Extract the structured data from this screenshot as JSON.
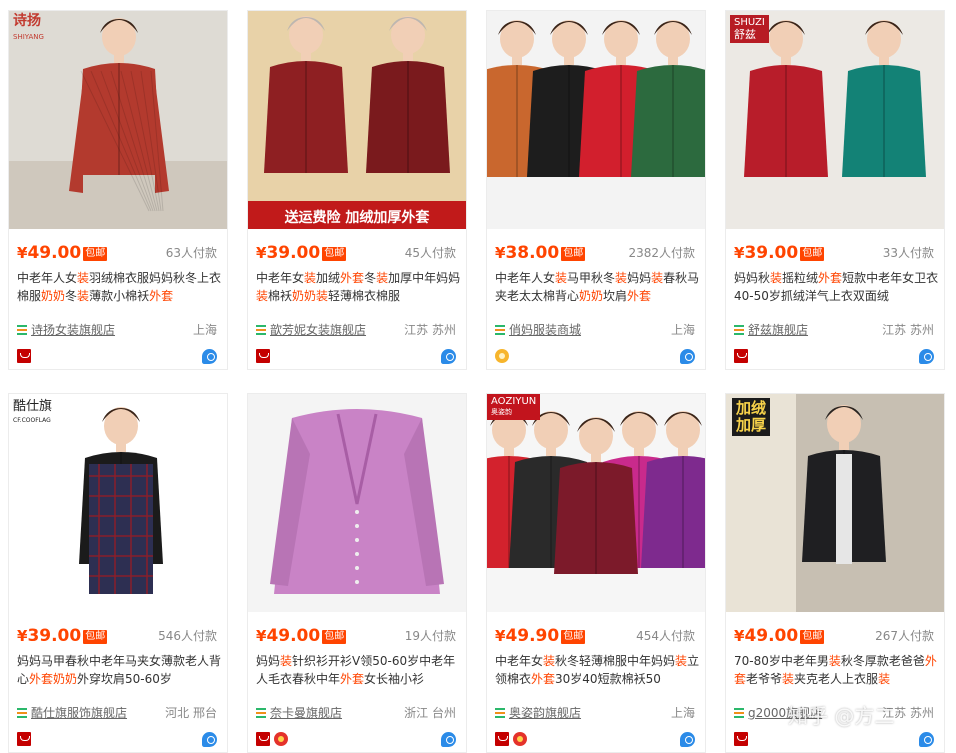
{
  "products": [
    {
      "price": "49.00",
      "yen": "¥",
      "badge": "包邮",
      "sales": "63人付款",
      "title_html": "中老年人女<span class=\"hl\">装</span>羽绒棉衣服妈妈秋冬上衣棉服<span class=\"hl\">奶奶</span>冬<span class=\"hl\">装</span>薄款小棉袄<span class=\"hl\">外套</span>",
      "title": "中老年人女装羽绒棉衣服妈妈秋冬上衣棉服奶奶冬装薄款小棉袄外套",
      "shop": "诗扬女装旗舰店",
      "location": "上海",
      "badges": [
        "tmall"
      ],
      "img_text": [
        "诗扬",
        "SHIYANG"
      ],
      "colors": [
        "#b33a2e"
      ],
      "bg": "#dedbd4"
    },
    {
      "price": "39.00",
      "yen": "¥",
      "badge": "包邮",
      "sales": "45人付款",
      "title_html": "中老年女<span class=\"hl\">装</span>加绒<span class=\"hl\">外套</span>冬<span class=\"hl\">装</span>加厚中年妈妈<span class=\"hl\">装</span>棉袄<span class=\"hl\">奶奶装</span>轻薄棉衣棉服",
      "title": "中老年女装加绒外套冬装加厚中年妈妈装棉袄奶奶装轻薄棉衣棉服",
      "shop": "歆芳妮女装旗舰店",
      "location": "江苏 苏州",
      "badges": [
        "tmall"
      ],
      "img_text": [
        "送运费险  加绒加厚外套"
      ],
      "colors": [
        "#8e1f22",
        "#7a1a1d"
      ],
      "bg": "#e8d2a8"
    },
    {
      "price": "38.00",
      "yen": "¥",
      "badge": "包邮",
      "sales": "2382人付款",
      "title_html": "中老年人女<span class=\"hl\">装</span>马甲秋冬<span class=\"hl\">装</span>妈妈<span class=\"hl\">装</span>春秋马夹老太太棉背心<span class=\"hl\">奶奶</span>坎肩<span class=\"hl\">外套</span>",
      "title": "中老年人女装马甲秋冬装妈妈装春秋马夹老太太棉背心奶奶坎肩外套",
      "shop": "俏妈服装商城",
      "location": "上海",
      "badges": [
        "gold"
      ],
      "img_text": [],
      "colors": [
        "#c9672e",
        "#1d1d1d",
        "#d21f2d",
        "#2c6a3e"
      ],
      "bg": "#f3f3f3"
    },
    {
      "price": "39.00",
      "yen": "¥",
      "badge": "包邮",
      "sales": "33人付款",
      "title_html": "妈妈秋<span class=\"hl\">装</span>摇粒绒<span class=\"hl\">外套</span>短款中老年女卫衣40-50岁抓绒洋气上衣双面绒",
      "title": "妈妈秋装摇粒绒外套短款中老年女卫衣40-50岁抓绒洋气上衣双面绒",
      "shop": "舒兹旗舰店",
      "location": "江苏 苏州",
      "badges": [
        "tmall"
      ],
      "img_text": [
        "SHUZI",
        "舒兹"
      ],
      "colors": [
        "#b81d2a",
        "#138276"
      ],
      "bg": "#ece9e4"
    },
    {
      "price": "39.00",
      "yen": "¥",
      "badge": "包邮",
      "sales": "546人付款",
      "title_html": "妈妈马甲春秋中老年马夹女薄款老人背心<span class=\"hl\">外套奶奶</span>外穿坎肩50-60岁",
      "title": "妈妈马甲春秋中老年马夹女薄款老人背心外套奶奶外穿坎肩50-60岁",
      "shop": "酷仕旗服饰旗舰店",
      "location": "河北 邢台",
      "badges": [
        "tmall"
      ],
      "img_text": [
        "酷仕旗",
        "CF.COOFLAG"
      ],
      "colors": [
        "#2d2f52"
      ],
      "bg": "#ffffff"
    },
    {
      "price": "49.00",
      "yen": "¥",
      "badge": "包邮",
      "sales": "19人付款",
      "title_html": "妈妈<span class=\"hl\">装</span>针织衫开衫V领50-60岁中老年人毛衣春秋中年<span class=\"hl\">外套</span>女长袖小衫",
      "title": "妈妈装针织衫开衫V领50-60岁中老年人毛衣春秋中年外套女长袖小衫",
      "shop": "奈卡曼旗舰店",
      "location": "浙江 台州",
      "badges": [
        "tmall",
        "flower"
      ],
      "img_text": [],
      "colors": [
        "#c983c6"
      ],
      "bg": "#f4f4f4"
    },
    {
      "price": "49.90",
      "yen": "¥",
      "badge": "包邮",
      "sales": "454人付款",
      "title_html": "中老年女<span class=\"hl\">装</span>秋冬轻薄棉服中年妈妈<span class=\"hl\">装</span>立领棉衣<span class=\"hl\">外套</span>30岁40短款棉袄50",
      "title": "中老年女装秋冬轻薄棉服中年妈妈装立领棉衣外套30岁40短款棉袄50",
      "shop": "奥姿韵旗舰店",
      "location": "上海",
      "badges": [
        "tmall",
        "flower"
      ],
      "img_text": [
        "AOZIYUN",
        "奥姿韵"
      ],
      "colors": [
        "#d3222d",
        "#2a2a2a",
        "#7c1a2a",
        "#c92a8c",
        "#7e2a8e"
      ],
      "bg": "#f6f6f6"
    },
    {
      "price": "49.00",
      "yen": "¥",
      "badge": "包邮",
      "sales": "267人付款",
      "title_html": "70-80岁中老年男<span class=\"hl\">装</span>秋冬厚款老爸爸<span class=\"hl\">外套</span>老爷爷<span class=\"hl\">装</span>夹克老人上衣服<span class=\"hl\">装</span>",
      "title": "70-80岁中老年男装秋冬厚款老爸爸外套老爷爷装夹克老人上衣服装",
      "shop": "g2000旗舰店",
      "location": "江苏 苏州",
      "badges": [
        "tmall"
      ],
      "img_text": [
        "加绒",
        "加厚"
      ],
      "colors": [
        "#1f1f22"
      ],
      "bg": "#c7bfb2"
    }
  ],
  "watermark": "知乎 @方二"
}
